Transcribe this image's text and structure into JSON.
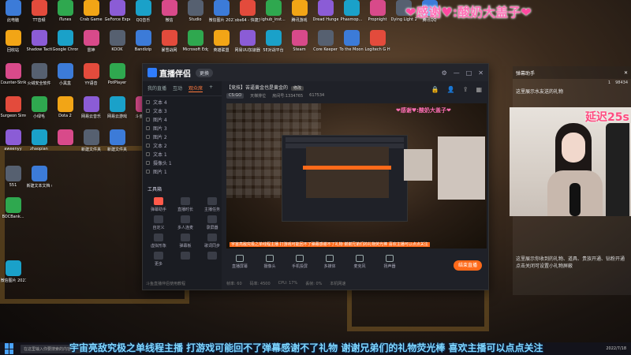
{
  "desktop": {
    "rows": [
      [
        "此电脑",
        "TT音频",
        "iTunes",
        "Crab Game",
        "GeForce Experience",
        "QQ音乐",
        "微信",
        "Studio",
        "微信图片 2021111...",
        "obs64 - 快捷方式",
        "ighub_inst...",
        "腾讯游戏",
        "Dread Hunger",
        "Phasmop...",
        "Propnight",
        "Dying Light 2",
        "腾讯QQ"
      ],
      [
        "回收站",
        "Shadow Tactics",
        "Google Chrome",
        "雷神",
        "KOOK",
        "Bandizip",
        "暴雪战网",
        "Microsoft Edge",
        "英雄联盟",
        "网易UU加速器",
        "5E对战平台",
        "Steam",
        "Core Keeper",
        "To the Moon",
        "Logitech G HUB"
      ],
      [
        "Counter-Strike",
        "火绒安全软件",
        "小黑盒",
        "YY语音",
        "PotPlayer"
      ],
      [
        "Surgeon Simulator",
        "小绿毛",
        "Dota 2",
        "网易云音乐",
        "网易云游戏",
        "斗鱼直播"
      ],
      [
        "aweenyy",
        "zhaopian",
        "",
        "新建文件夹",
        "新建文件夹"
      ],
      [
        "551",
        "新建文本文档 (3)"
      ],
      [
        "BOCBank..."
      ],
      [
        "微信图片 2021051..."
      ]
    ]
  },
  "thanks_banner": {
    "heart_left": "❤",
    "label": "感谢",
    "heart_mid": "♥",
    "colon": ":",
    "name": "酸奶大盖子",
    "heart_right": "❤"
  },
  "broadcast": {
    "app_name": "直播伴侣",
    "title_pill": "更换",
    "side_tabs": [
      "我的直播",
      "互动",
      "观众席"
    ],
    "scenes": [
      "文本 4",
      "文本 3",
      "图片 4",
      "图片 3",
      "图片 2",
      "文本 2",
      "文本 1",
      "摄像头 1",
      "图片 1"
    ],
    "toolbox_title": "工具箱",
    "tools": [
      "弹幕助手",
      "直播时长",
      "主播任务",
      "自定义",
      "多人连麦",
      "录屏器",
      "虚拟形象",
      "弹幕板",
      "歌词同步",
      "更多",
      "",
      ""
    ],
    "side_footer": "斗鱼直播伴侣使用教程",
    "stream_title": "【竞技】苦逼黄金也是黄金的",
    "stream_tag": "修改",
    "stream_meta": [
      "CS:GO",
      "天梯排位",
      "房间号:1334765",
      "617534"
    ],
    "preview_sub": "宇宙亮敌究极之单线程主播 打游戏可能回不了弹幕感谢不了礼物 谢谢兄弟们的礼物荧光棒 喜欢主播可以点点关注",
    "controls": [
      "直播屏幕",
      "摄像头",
      "手机投屏",
      "多媒体",
      "麦克风",
      "扬声器"
    ],
    "go_live_label": "结束直播",
    "status": [
      "帧率: 60",
      "码率: 4500",
      "CPU: 17%",
      "丢帧: 0%",
      "本机网速"
    ]
  },
  "chat": {
    "title": "弹幕助手",
    "stats": [
      "1",
      "98434"
    ],
    "lines": [
      "这里展示水友送的礼物",
      "",
      ""
    ],
    "bottom_lines": [
      "这里展示你收到的礼物、道具、贵族开通、钻粉开通",
      "点击关闭可设置小礼物屏蔽"
    ]
  },
  "overlay": {
    "delay_label": "延迟25s",
    "ticker": "宇宙亮敌究极之单线程主播 打游戏可能回不了弹幕感谢不了礼物 谢谢兄弟们的礼物荧光棒 喜欢主播可以点点关注"
  },
  "taskbar": {
    "search_placeholder": "在这里输入你要搜索的内容",
    "clock": "2022/7/18"
  },
  "colors": {
    "accent": "#ff6a1a",
    "banner_pink": "#ff6fb5",
    "ticker_blue": "#7fd7ff"
  }
}
